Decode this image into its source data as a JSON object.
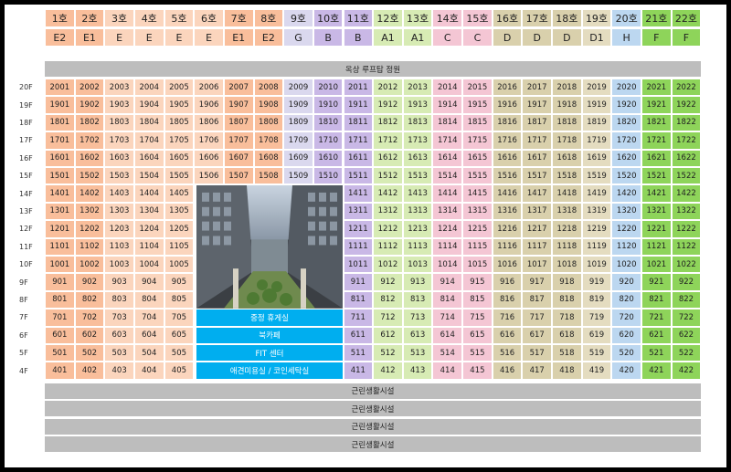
{
  "columns": [
    {
      "num": "1호",
      "type": "E2",
      "color": "#f9be9b"
    },
    {
      "num": "2호",
      "type": "E1",
      "color": "#f9be9b"
    },
    {
      "num": "3호",
      "type": "E",
      "color": "#fbd5bd"
    },
    {
      "num": "4호",
      "type": "E",
      "color": "#fbd5bd"
    },
    {
      "num": "5호",
      "type": "E",
      "color": "#fbd5bd"
    },
    {
      "num": "6호",
      "type": "E",
      "color": "#fbd5bd"
    },
    {
      "num": "7호",
      "type": "E1",
      "color": "#f9be9b"
    },
    {
      "num": "8호",
      "type": "E2",
      "color": "#f9be9b"
    },
    {
      "num": "9호",
      "type": "G",
      "color": "#dad8ee"
    },
    {
      "num": "10호",
      "type": "B",
      "color": "#c9b8e6"
    },
    {
      "num": "11호",
      "type": "B",
      "color": "#c9b8e6"
    },
    {
      "num": "12호",
      "type": "A1",
      "color": "#d7ebb4"
    },
    {
      "num": "13호",
      "type": "A1",
      "color": "#d7ebb4"
    },
    {
      "num": "14호",
      "type": "C",
      "color": "#f4c6d4"
    },
    {
      "num": "15호",
      "type": "C",
      "color": "#f4c6d4"
    },
    {
      "num": "16호",
      "type": "D",
      "color": "#d9d0ac"
    },
    {
      "num": "17호",
      "type": "D",
      "color": "#d9d0ac"
    },
    {
      "num": "18호",
      "type": "D",
      "color": "#d9d0ac"
    },
    {
      "num": "19호",
      "type": "D1",
      "color": "#e4dcc0"
    },
    {
      "num": "20호",
      "type": "H",
      "color": "#bcd7f0"
    },
    {
      "num": "21호",
      "type": "F",
      "color": "#8ed45a"
    },
    {
      "num": "22호",
      "type": "F",
      "color": "#8ed45a"
    }
  ],
  "rooftop_label": "옥상 루프탑 정원",
  "floors": [
    "20F",
    "19F",
    "18F",
    "17F",
    "16F",
    "15F",
    "14F",
    "13F",
    "12F",
    "11F",
    "10F",
    "9F",
    "8F",
    "7F",
    "6F",
    "5F",
    "4F"
  ],
  "amenities": [
    "중정 휴게실",
    "북카페",
    "FIT 센터",
    "애견미용실 / 코인세탁실"
  ],
  "commercial_label": "근린생활시설",
  "commercial_rows": 4,
  "photo_icon": "atrium-photo"
}
